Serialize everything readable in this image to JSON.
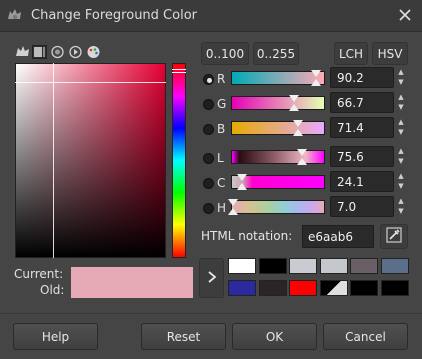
{
  "window": {
    "title": "Change Foreground Color",
    "app_icon": "gimp-wilber-icon",
    "close_icon": "close-icon"
  },
  "selector_tabs": [
    {
      "name": "scales-icon"
    },
    {
      "name": "gimp-selector-icon"
    },
    {
      "name": "watercolor-icon"
    },
    {
      "name": "wheel-icon"
    },
    {
      "name": "palette-icon"
    }
  ],
  "range_buttons": {
    "r100": "0..100",
    "r255": "0..255"
  },
  "model_buttons": {
    "lch": "LCH",
    "hsv": "HSV"
  },
  "channels": [
    {
      "key": "R",
      "label": "R",
      "value": "90.2",
      "fraction": 0.902,
      "selected": true
    },
    {
      "key": "G",
      "label": "G",
      "value": "66.7",
      "fraction": 0.667,
      "selected": false
    },
    {
      "key": "B",
      "label": "B",
      "value": "71.4",
      "fraction": 0.714,
      "selected": false
    },
    {
      "key": "L",
      "label": "L",
      "value": "75.6",
      "fraction": 0.756,
      "selected": false
    },
    {
      "key": "C",
      "label": "C",
      "value": "24.1",
      "fraction": 0.12,
      "selected": false
    },
    {
      "key": "H",
      "label": "H",
      "value": "7.0",
      "fraction": 0.02,
      "selected": false
    }
  ],
  "hex": {
    "label": "HTML notation:",
    "value": "e6aab6",
    "picker_icon": "color-picker-icon"
  },
  "swatches": {
    "current_label": "Current:",
    "old_label": "Old:",
    "current_color": "#e6aab6",
    "old_color": "#e6aab6"
  },
  "history": {
    "arrow_icon": "chevron-right-icon",
    "colors": [
      "#ffffff",
      "#000000",
      "#c8ccd2",
      "#c4c8cc",
      "#6a5f66",
      "#5b6e8a",
      "#2a2aa0",
      "#2a2424",
      "#ff0000",
      "fg-bg-icon",
      "#000000",
      "#000000"
    ]
  },
  "buttons": {
    "help": "Help",
    "reset": "Reset",
    "ok": "OK",
    "cancel": "Cancel"
  }
}
